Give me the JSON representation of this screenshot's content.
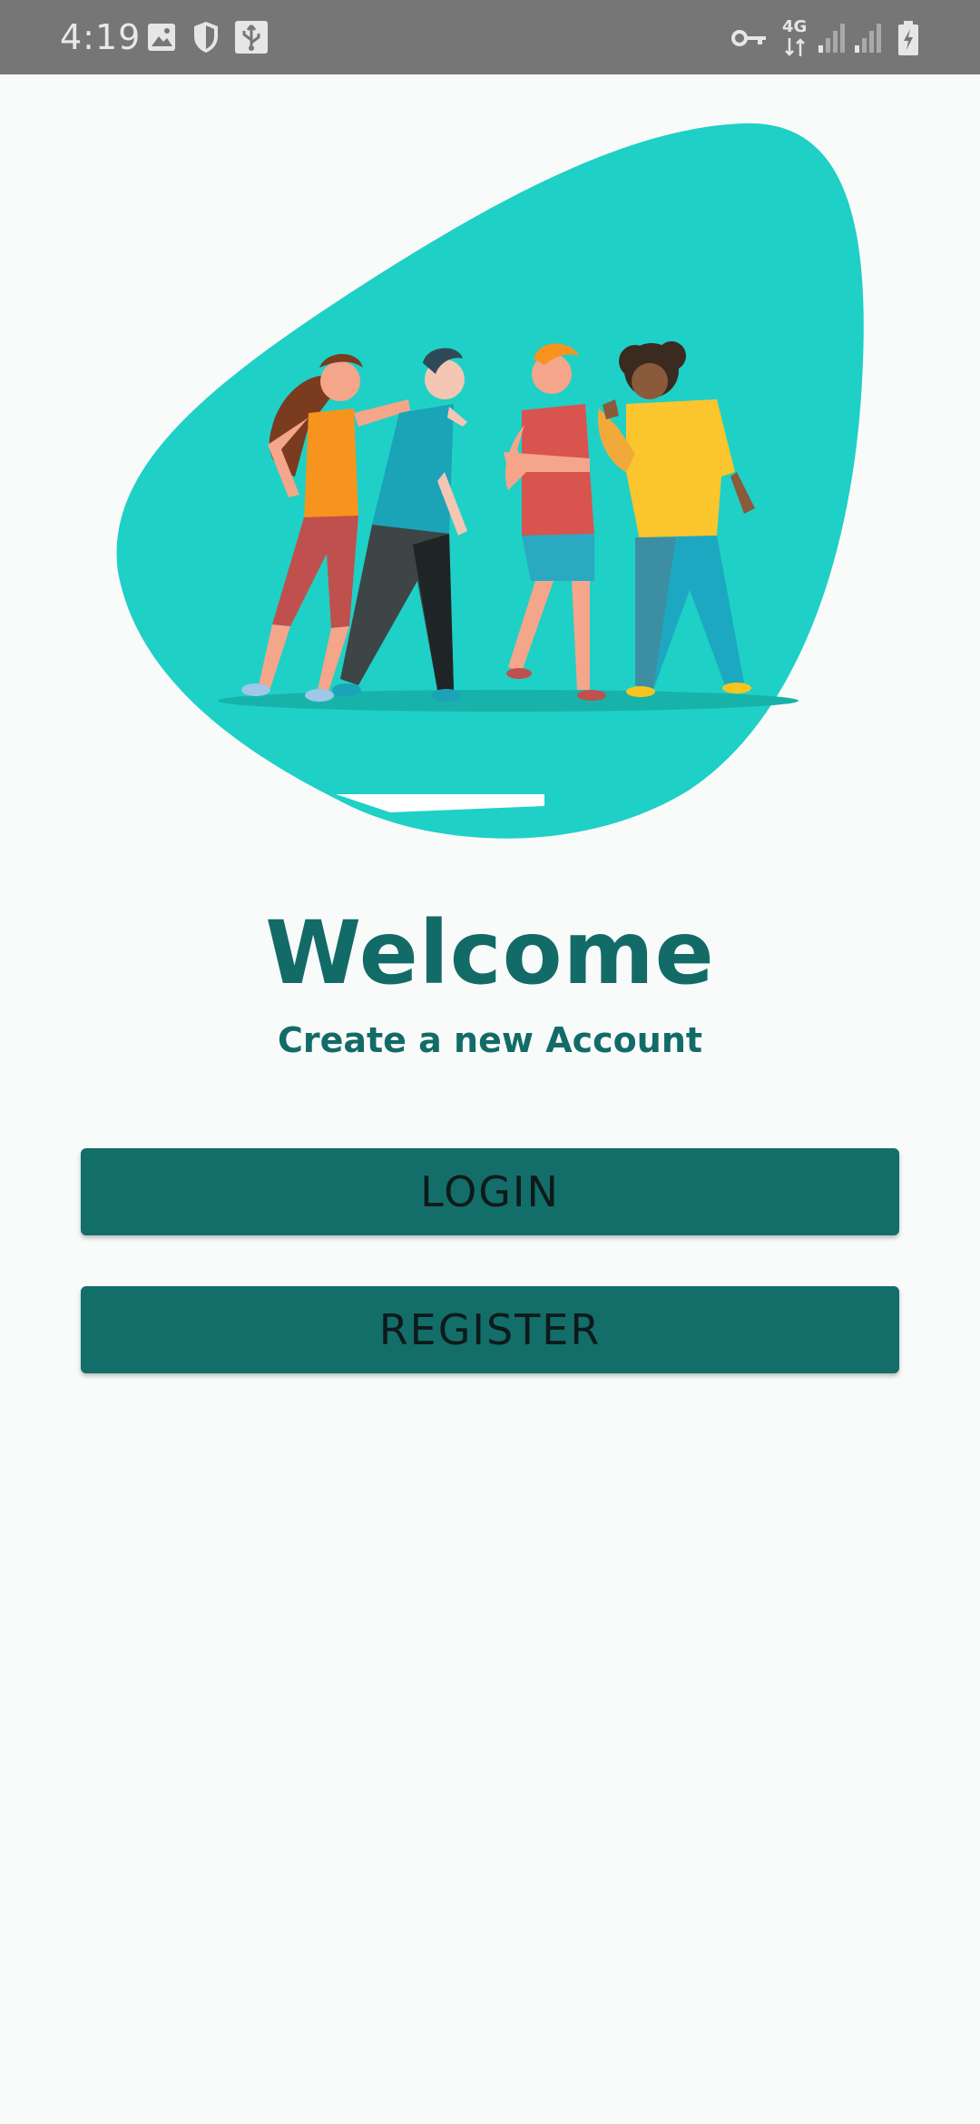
{
  "status_bar": {
    "time": "4:19",
    "network_label": "4G",
    "icons": [
      "image-icon",
      "shield-icon",
      "usb-icon",
      "vpn-key-icon",
      "network-4g-icon",
      "signal-icon",
      "signal-icon",
      "battery-charging-icon"
    ]
  },
  "hero": {
    "illustration": "group-of-people-illustration",
    "blob_color": "#1fd0c6"
  },
  "welcome": {
    "title": "Welcome",
    "subtitle": "Create a new Account"
  },
  "buttons": {
    "login_label": "LOGIN",
    "register_label": "REGISTER"
  },
  "colors": {
    "accent": "#136e69",
    "status_bar": "#767676",
    "background": "#f9fafa"
  }
}
